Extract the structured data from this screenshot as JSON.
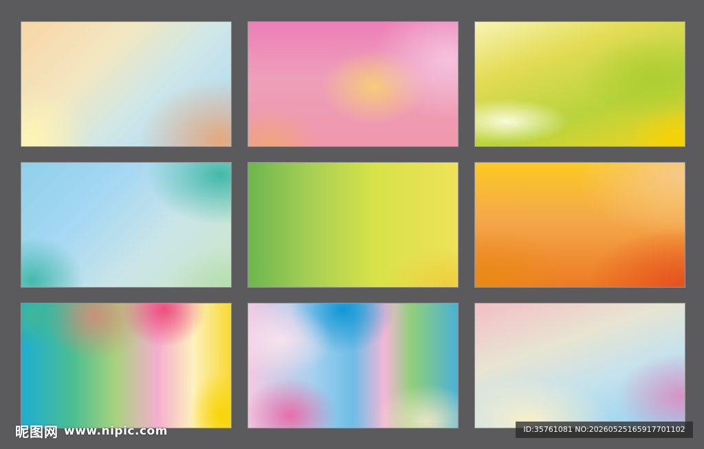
{
  "swatches": [
    {
      "name": "peach-to-sky-blue"
    },
    {
      "name": "pink-with-yellow-glow"
    },
    {
      "name": "lime-yellow-green"
    },
    {
      "name": "teal-sky-blue"
    },
    {
      "name": "green-to-yellow"
    },
    {
      "name": "yellow-to-orange"
    },
    {
      "name": "rainbow-teal-pink-yellow"
    },
    {
      "name": "blue-pink-green-mix"
    },
    {
      "name": "pastel-pink-blue"
    }
  ],
  "watermark": {
    "brand": "昵图网",
    "url": "www.nipic.com",
    "id_text": "ID:35761081 NO:20260525165917701102"
  }
}
